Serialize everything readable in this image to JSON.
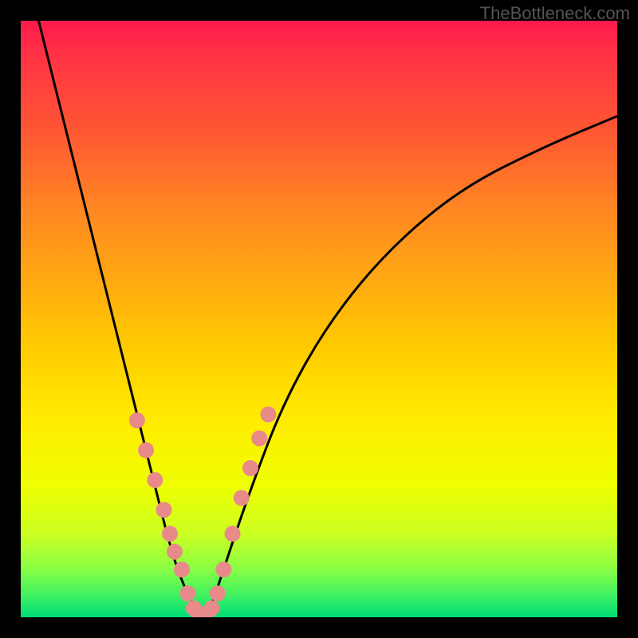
{
  "watermark": "TheBottleneck.com",
  "chart_data": {
    "type": "line",
    "title": "",
    "xlabel": "",
    "ylabel": "",
    "xlim": [
      0,
      100
    ],
    "ylim": [
      0,
      100
    ],
    "background_gradient": {
      "top": "#ff1a4d",
      "mid": "#ffee00",
      "bottom": "#00dd77"
    },
    "series": [
      {
        "name": "bottleneck-curve",
        "color": "#000000",
        "x": [
          3,
          6,
          10,
          14,
          18,
          22,
          25,
          27,
          29,
          30,
          31,
          32,
          34,
          38,
          44,
          52,
          62,
          74,
          88,
          100
        ],
        "y": [
          100,
          88,
          72,
          56,
          40,
          24,
          12,
          6,
          2,
          0,
          0,
          2,
          8,
          20,
          36,
          50,
          62,
          72,
          79,
          84
        ]
      }
    ],
    "markers": [
      {
        "name": "highlight-points",
        "color": "#e88a8a",
        "points": [
          {
            "x": 19.5,
            "y": 33
          },
          {
            "x": 21,
            "y": 28
          },
          {
            "x": 22.5,
            "y": 23
          },
          {
            "x": 24,
            "y": 18
          },
          {
            "x": 25,
            "y": 14
          },
          {
            "x": 25.8,
            "y": 11
          },
          {
            "x": 27,
            "y": 8
          },
          {
            "x": 28,
            "y": 4
          },
          {
            "x": 29,
            "y": 1.5
          },
          {
            "x": 30,
            "y": 0.5
          },
          {
            "x": 31,
            "y": 0.5
          },
          {
            "x": 32,
            "y": 1.5
          },
          {
            "x": 33,
            "y": 4
          },
          {
            "x": 34,
            "y": 8
          },
          {
            "x": 35.5,
            "y": 14
          },
          {
            "x": 37,
            "y": 20
          },
          {
            "x": 38.5,
            "y": 25
          },
          {
            "x": 40,
            "y": 30
          },
          {
            "x": 41.5,
            "y": 34
          }
        ]
      }
    ]
  }
}
